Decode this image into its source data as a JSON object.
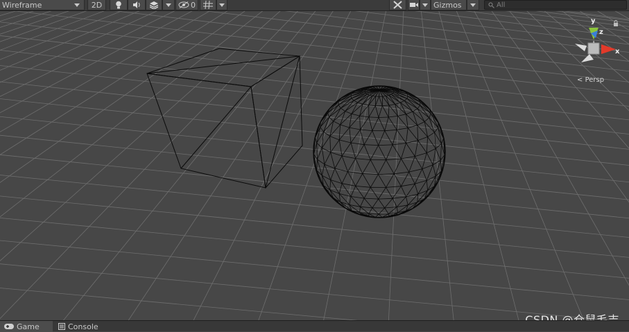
{
  "toolbar": {
    "draw_mode": "Wireframe",
    "mode_2d": "2D",
    "hidden_count": "0",
    "gizmos": "Gizmos",
    "search_placeholder": "All",
    "icons": [
      "lighting-icon",
      "audio-icon",
      "effects-icon",
      "hidden-objects-icon",
      "grid-icon",
      "tools-icon",
      "camera-icon",
      "search-icon"
    ]
  },
  "scene": {
    "projection_label": "Persp",
    "axis_x": "x",
    "axis_y": "y",
    "axis_z": "z",
    "colors": {
      "background": "#474747",
      "grid": "#7a7a7a",
      "wire": "#0a0a0a",
      "axis_x": "#e23a2a",
      "axis_y": "#8bc43b",
      "axis_z": "#3a7fd8"
    }
  },
  "bottom_tabs": [
    {
      "label": "Game",
      "icon": "gamepad-icon"
    },
    {
      "label": "Console",
      "icon": "console-icon"
    }
  ],
  "watermark": "CSDN @仓鼠毛吉"
}
